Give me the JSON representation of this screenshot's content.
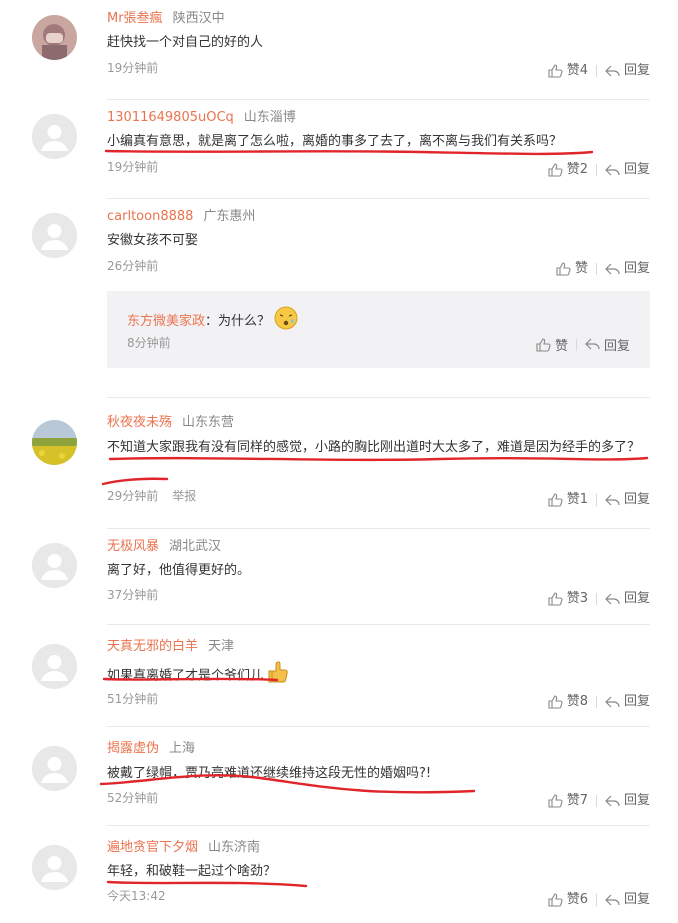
{
  "comments": [
    {
      "user": "Mr張叁瘋",
      "location": "陕西汉中",
      "text": "赶快找一个对自己的好的人",
      "time": "19分钟前",
      "likes": "赞4",
      "reply": "回复"
    },
    {
      "user": "13011649805uOCq",
      "location": "山东淄博",
      "text": "小编真有意思，就是离了怎么啦，离婚的事多了去了，离不离与我们有关系吗？",
      "time": "19分钟前",
      "likes": "赞2",
      "reply": "回复"
    },
    {
      "user": "carltoon8888",
      "location": "广东惠州",
      "text": "安徽女孩不可娶",
      "time": "26分钟前",
      "likes": "赞",
      "reply": "回复"
    },
    {
      "user": "秋夜夜未殇",
      "location": "山东东营",
      "text": "不知道大家跟我有没有同样的感觉，小路的胸比刚出道时大太多了，难道是因为经手的多了？",
      "time": "29分钟前",
      "report": "举报",
      "likes": "赞1",
      "reply": "回复"
    },
    {
      "user": "无极风暴",
      "location": "湖北武汉",
      "text": "离了好，他值得更好的。",
      "time": "37分钟前",
      "likes": "赞3",
      "reply": "回复"
    },
    {
      "user": "天真无邪的白羊",
      "location": "天津",
      "text": "如果真离婚了才是个爷们儿",
      "time": "51分钟前",
      "likes": "赞8",
      "reply": "回复"
    },
    {
      "user": "揭露虚伪",
      "location": "上海",
      "text": "被戴了绿帽，贾乃亮难道还继续维持这段无性的婚姻吗?!",
      "time": "52分钟前",
      "likes": "赞7",
      "reply": "回复"
    },
    {
      "user": "遍地贪官下夕烟",
      "location": "山东济南",
      "text": "年轻，和破鞋一起过个啥劲？",
      "time": "今天13:42",
      "likes": "赞6",
      "reply": "回复"
    }
  ],
  "reply": {
    "user": "东方微美家政",
    "colon": "：",
    "text": "为什么？",
    "time": "8分钟前",
    "likes": "赞",
    "reply": "回复"
  },
  "colors": {
    "username": "#eb7350",
    "annotation": "#e0262b",
    "reply_bg": "#f2f2f5"
  }
}
